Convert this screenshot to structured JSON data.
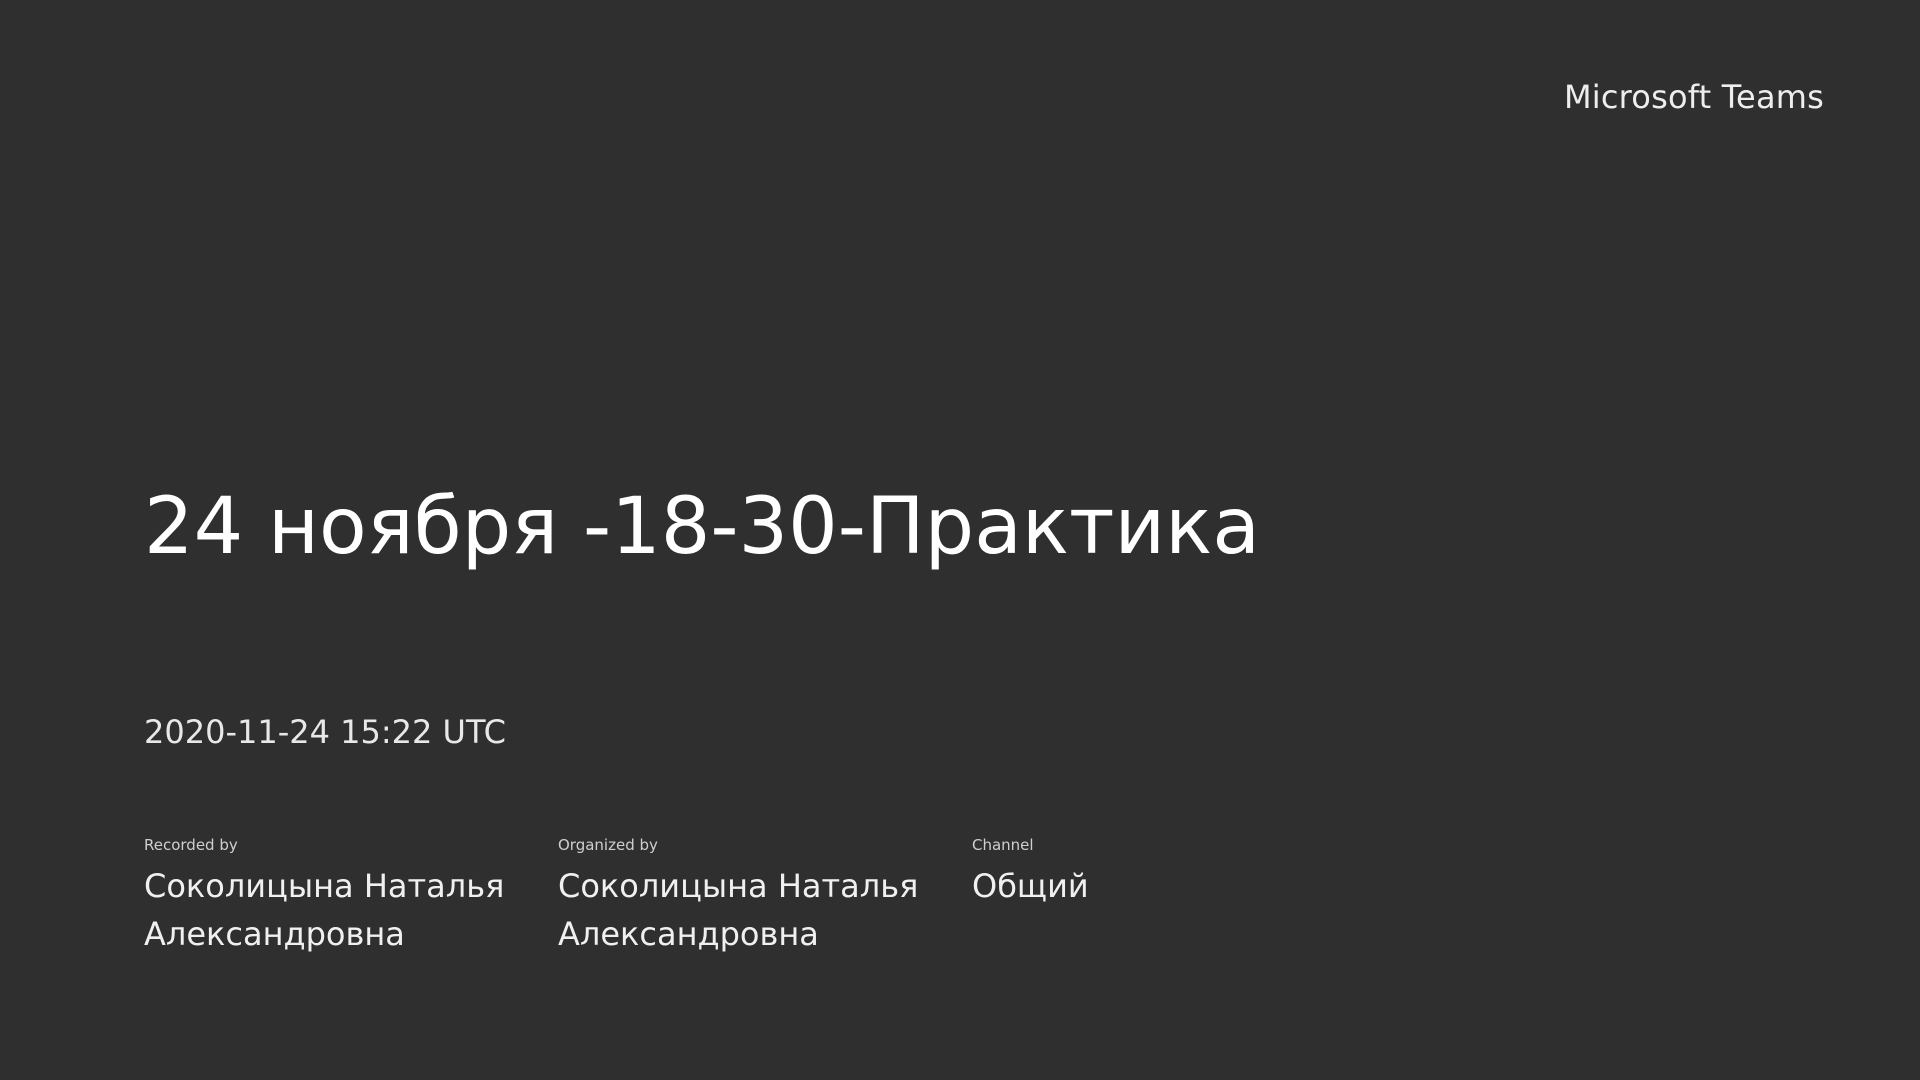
{
  "brand": "Microsoft Teams",
  "title": "24 ноября -18-30-Практика",
  "timestamp": "2020-11-24 15:22 UTC",
  "meta": {
    "recorded_by": {
      "label": "Recorded by",
      "value": "Соколицына Наталья Александровна"
    },
    "organized_by": {
      "label": "Organized by",
      "value": "Соколицына Наталья Александровна"
    },
    "channel": {
      "label": "Channel",
      "value": "Общий"
    }
  },
  "colors": {
    "background": "#2f2f2f",
    "text": "#ffffff"
  }
}
